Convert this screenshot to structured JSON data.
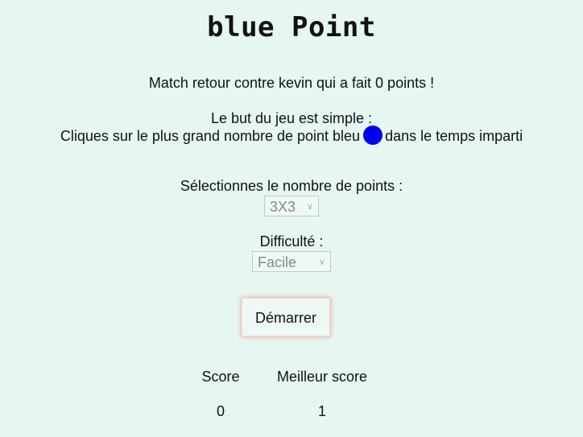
{
  "title": "blue Point",
  "rematch_text": "Match retour contre kevin qui a fait 0 points !",
  "goal_line1": "Le but du jeu est simple :",
  "goal_line2_before": "Cliques sur le plus grand nombre de point bleu",
  "goal_line2_after": "dans le temps imparti",
  "dot_color": "#0000ee",
  "points_label": "Sélectionnes le nombre de points :",
  "points_select": {
    "value": "3X3"
  },
  "difficulty_label": "Difficulté :",
  "difficulty_select": {
    "value": "Facile"
  },
  "start_button": "Démarrer",
  "score": {
    "label": "Score",
    "value": "0"
  },
  "best_score": {
    "label": "Meilleur score",
    "value": "1"
  }
}
